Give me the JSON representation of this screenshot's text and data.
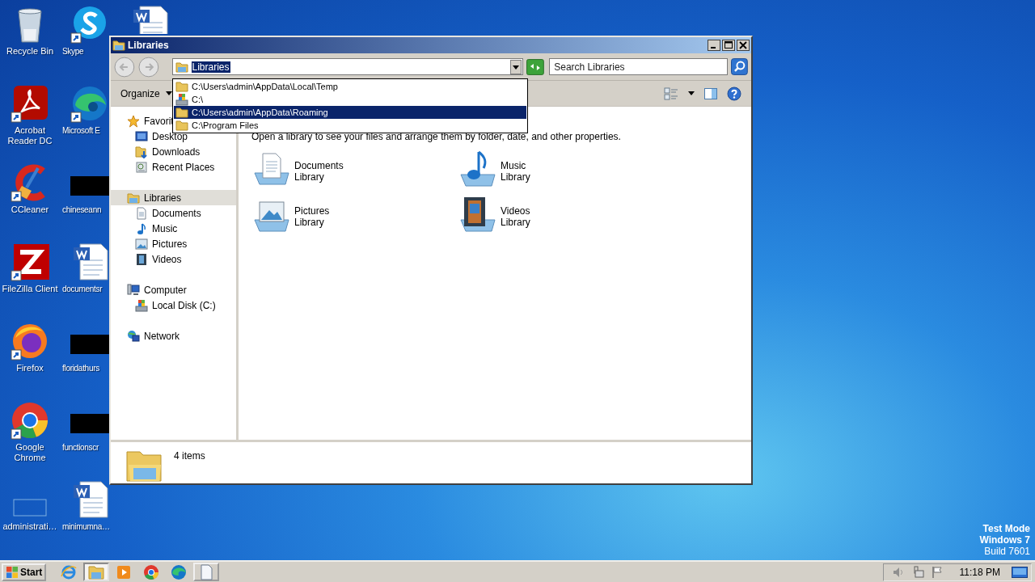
{
  "desktop": {
    "icons": [
      {
        "label": "Recycle Bin",
        "kind": "recycle",
        "shortcut": false
      },
      {
        "label": "Acrobat Reader DC",
        "kind": "acrobat",
        "shortcut": true
      },
      {
        "label": "CCleaner",
        "kind": "ccleaner",
        "shortcut": true
      },
      {
        "label": "FileZilla Client",
        "kind": "filezilla",
        "shortcut": true
      },
      {
        "label": "Firefox",
        "kind": "firefox",
        "shortcut": true
      },
      {
        "label": "Google Chrome",
        "kind": "chrome",
        "shortcut": true
      },
      {
        "label": "administrati…",
        "kind": "blank",
        "shortcut": false
      },
      {
        "label": "Skype",
        "kind": "skype",
        "shortcut": true
      },
      {
        "label": "Microsoft E",
        "kind": "edge",
        "shortcut": true
      },
      {
        "label": "chineseann",
        "kind": "redacted",
        "shortcut": false
      },
      {
        "label": "documentsr",
        "kind": "word",
        "shortcut": false
      },
      {
        "label": "floridathurs",
        "kind": "redacted",
        "shortcut": false
      },
      {
        "label": "functionscr",
        "kind": "redacted",
        "shortcut": false
      },
      {
        "label": "minimumna…",
        "kind": "word",
        "shortcut": false
      },
      {
        "kind": "word",
        "shortcut": false
      }
    ],
    "watermark_text": [
      "Test Mode",
      "Windows 7",
      "Build 7601"
    ]
  },
  "window": {
    "title": "Libraries",
    "nav": {
      "back": {
        "disabled": true
      },
      "forward": {
        "disabled": true
      }
    },
    "address": {
      "value": "Libraries",
      "selected": true
    },
    "address_history": [
      {
        "path": "C:\\Users\\admin\\AppData\\Local\\Temp",
        "kind": "folder",
        "selected": false
      },
      {
        "path": "C:\\",
        "kind": "drive",
        "selected": false
      },
      {
        "path": "C:\\Users\\admin\\AppData\\Roaming",
        "kind": "folder",
        "selected": true
      },
      {
        "path": "C:\\Program Files",
        "kind": "folder",
        "selected": false
      }
    ],
    "search": {
      "placeholder": "Search Libraries"
    },
    "toolbar": {
      "organize": "Organize"
    },
    "sidebar": [
      {
        "label": "Favorit",
        "kind": "star",
        "selected": false,
        "children": [
          {
            "label": "Desktop",
            "kind": "desktop",
            "selected": false
          },
          {
            "label": "Downloads",
            "kind": "downloads",
            "selected": false
          },
          {
            "label": "Recent Places",
            "kind": "recent",
            "selected": false
          }
        ]
      },
      {
        "label": "Libraries",
        "kind": "library",
        "selected": true,
        "children": [
          {
            "label": "Documents",
            "kind": "documents",
            "selected": false
          },
          {
            "label": "Music",
            "kind": "music",
            "selected": false
          },
          {
            "label": "Pictures",
            "kind": "pictures",
            "selected": false
          },
          {
            "label": "Videos",
            "kind": "videos",
            "selected": false
          }
        ]
      },
      {
        "label": "Computer",
        "kind": "computer",
        "selected": false,
        "children": [
          {
            "label": "Local Disk (C:)",
            "kind": "disk",
            "selected": false
          }
        ]
      },
      {
        "label": "Network",
        "kind": "network",
        "selected": false
      }
    ],
    "hint": "Open a library to see your files and arrange them by folder, date, and other properties.",
    "libraries": [
      {
        "name": "Documents",
        "type": "Library",
        "kind": "documents"
      },
      {
        "name": "Music",
        "type": "Library",
        "kind": "music"
      },
      {
        "name": "Pictures",
        "type": "Library",
        "kind": "pictures"
      },
      {
        "name": "Videos",
        "type": "Library",
        "kind": "videos"
      }
    ],
    "details": "4 items"
  },
  "taskbar": {
    "start": "Start",
    "items": [
      {
        "kind": "ie",
        "pressed": false,
        "running": false
      },
      {
        "kind": "explorer",
        "pressed": true,
        "running": true
      },
      {
        "kind": "media",
        "pressed": false,
        "running": false
      },
      {
        "kind": "chrome",
        "pressed": false,
        "running": false
      },
      {
        "kind": "edge",
        "pressed": false,
        "running": false
      },
      {
        "kind": "document",
        "pressed": false,
        "running": true
      }
    ],
    "clock": "11:18 PM"
  }
}
